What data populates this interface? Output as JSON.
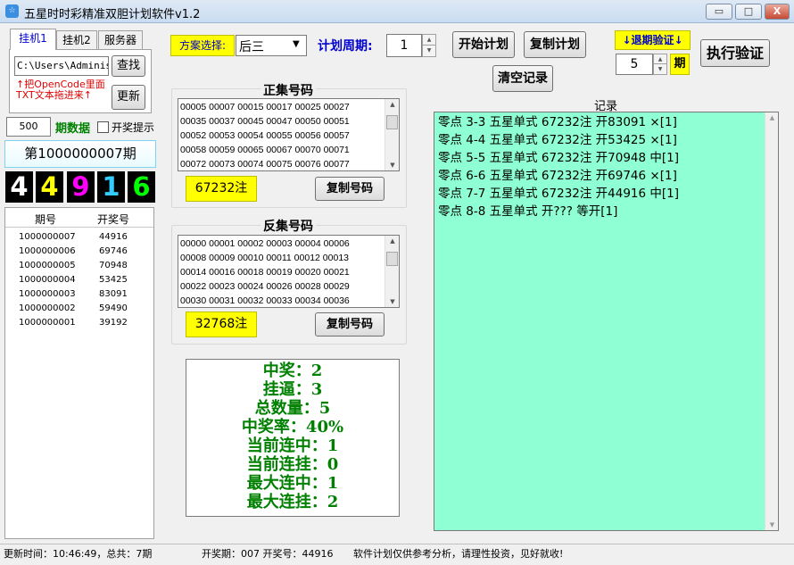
{
  "window": {
    "title": "五星时时彩精准双胆计划软件v1.2",
    "app_icon": "☆",
    "min_label": "▭",
    "max_label": "□",
    "close_label": "X"
  },
  "tabs": [
    {
      "label": "挂机1",
      "active": true
    },
    {
      "label": "挂机2",
      "active": false
    },
    {
      "label": "服务器",
      "active": false
    }
  ],
  "file_panel": {
    "path_value": "C:\\Users\\Administ",
    "find_label": "查找",
    "update_label": "更新",
    "hint_line1": "↑把OpenCode里面",
    "hint_line2": "TXT文本拖进来↑"
  },
  "period_data": {
    "value": "500",
    "label": "期数据",
    "prize_hint_label": "开奖提示",
    "prize_hint_checked": false
  },
  "current_issue": "第1000000007期",
  "digits": [
    {
      "value": "4",
      "color": "#ffffff"
    },
    {
      "value": "4",
      "color": "#ffff00"
    },
    {
      "value": "9",
      "color": "#ff00ff"
    },
    {
      "value": "1",
      "color": "#33ccff"
    },
    {
      "value": "6",
      "color": "#00ff00"
    }
  ],
  "history": {
    "headers": [
      "期号",
      "开奖号"
    ],
    "rows": [
      [
        "1000000007",
        "44916"
      ],
      [
        "1000000006",
        "69746"
      ],
      [
        "1000000005",
        "70948"
      ],
      [
        "1000000004",
        "53425"
      ],
      [
        "1000000003",
        "83091"
      ],
      [
        "1000000002",
        "59490"
      ],
      [
        "1000000001",
        "39192"
      ]
    ]
  },
  "scheme": {
    "label": "方案选择:",
    "selected": "后三",
    "dropdown_icon": "▼"
  },
  "plan_period": {
    "label": "计划周期:",
    "value": "1"
  },
  "buttons": {
    "start_plan": "开始计划",
    "copy_plan": "复制计划",
    "clear_record": "清空记录",
    "execute_verify": "执行验证",
    "copy_numbers": "复制号码"
  },
  "backtest": {
    "label": "↓退期验证↓",
    "value": "5",
    "unit": "期"
  },
  "positive_set": {
    "title": "正集号码",
    "rows": [
      "00005  00007  00015  00017  00025  00027",
      "00035  00037  00045  00047  00050  00051",
      "00052  00053  00054  00055  00056  00057",
      "00058  00059  00065  00067  00070  00071",
      "00072  00073  00074  00075  00076  00077"
    ],
    "count": "67232注"
  },
  "negative_set": {
    "title": "反集号码",
    "rows": [
      "00000  00001  00002  00003  00004  00006",
      "00008  00009  00010  00011  00012  00013",
      "00014  00016  00018  00019  00020  00021",
      "00022  00023  00024  00026  00028  00029",
      "00030  00031  00032  00033  00034  00036"
    ],
    "count": "32768注"
  },
  "stats": [
    "中奖：2",
    "挂逼：3",
    "总数量：5",
    "中奖率：40%",
    "当前连中：1",
    "当前连挂：0",
    "最大连中：1",
    "最大连挂：2"
  ],
  "record": {
    "title": "记录",
    "lines": [
      "零点 3-3 五星单式 67232注 开83091 ×[1]",
      "零点 4-4 五星单式 67232注 开53425 ×[1]",
      "零点 5-5 五星单式 67232注 开70948 中[1]",
      "零点 6-6 五星单式 67232注 开69746 ×[1]",
      "零点 7-7 五星单式 67232注 开44916 中[1]",
      "零点 8-8 五星单式 开???  等开[1]"
    ]
  },
  "status_bar": {
    "update_time": "更新时间：10:46:49，总共：7期",
    "draw_info": "开奖期：007 开奖号：44916",
    "disclaimer": "软件计划仅供参考分析，请理性投资，见好就收!"
  }
}
